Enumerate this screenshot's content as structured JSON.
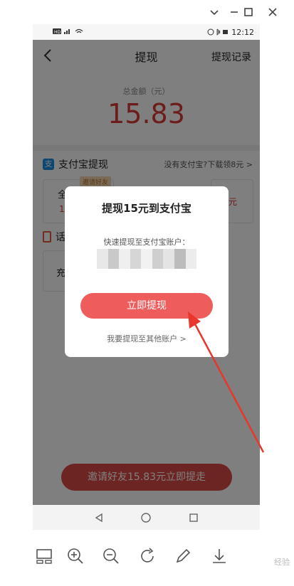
{
  "status": {
    "left_icons": "HD 4G signal wifi",
    "time": "12:12"
  },
  "header": {
    "title": "提现",
    "record_link": "提现记录"
  },
  "balance": {
    "label": "总金额（元）",
    "amount": "15.83"
  },
  "alipay": {
    "title": "支付宝提现",
    "link": "没有支付宝?下载领8元 >",
    "tag": "邀请好友",
    "card_a_title": "全",
    "card_a_sub": "1",
    "card_b_sub": "元"
  },
  "phone_section": {
    "title": "话",
    "card_c_title": "充"
  },
  "invite_button": "邀请好友15.83元立即提走",
  "dialog": {
    "title": "提现15元到支付宝",
    "subtitle": "快速提现至支付宝账户：",
    "confirm_button": "立即提现",
    "other_link": "我要提现至其他账户 >"
  },
  "watermark": "经验",
  "colors": {
    "accent": "#d93a36",
    "dialog_button": "#ef5c5c",
    "arrow": "#e8362d",
    "alipay_blue": "#1b8fe3"
  },
  "icons": {
    "back": "chevron-left-icon",
    "nav_back": "triangle-back-icon",
    "nav_home": "circle-home-icon",
    "nav_recent": "square-recent-icon"
  }
}
